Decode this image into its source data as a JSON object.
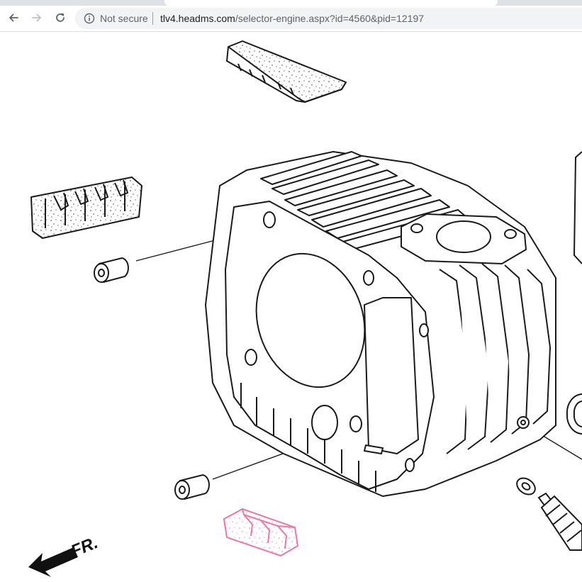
{
  "browser": {
    "security_label": "Not secure",
    "url_host": "tlv4.headms.com",
    "url_path": "/selector-engine.aspx?id=4560&pid=12197"
  },
  "diagram": {
    "direction_label": "FR.",
    "highlight_color": "#e879a8",
    "line_color": "#1a1a1a"
  }
}
